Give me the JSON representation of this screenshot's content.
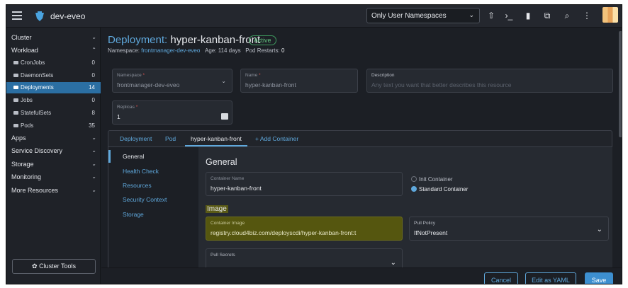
{
  "header": {
    "cluster_name": "dev-eveo",
    "namespace_filter": "Only User Namespaces",
    "icons": [
      "upload-icon",
      "kubectl-shell-icon",
      "file-icon",
      "copy-icon",
      "search-icon",
      "more-vert-icon"
    ]
  },
  "sidebar": {
    "sections": [
      {
        "label": "Cluster",
        "chev": "⌄"
      },
      {
        "label": "Workload",
        "chev": "⌃"
      }
    ],
    "workload_items": [
      {
        "label": "CronJobs",
        "count": "0"
      },
      {
        "label": "DaemonSets",
        "count": "0"
      },
      {
        "label": "Deployments",
        "count": "14"
      },
      {
        "label": "Jobs",
        "count": "0"
      },
      {
        "label": "StatefulSets",
        "count": "8"
      },
      {
        "label": "Pods",
        "count": "35"
      }
    ],
    "more_sections": [
      {
        "label": "Apps",
        "chev": "⌄"
      },
      {
        "label": "Service Discovery",
        "chev": "⌄"
      },
      {
        "label": "Storage",
        "chev": "⌄"
      },
      {
        "label": "Monitoring",
        "chev": "⌄"
      },
      {
        "label": "More Resources",
        "chev": "⌄"
      }
    ],
    "cluster_tools": "Cluster Tools"
  },
  "page": {
    "title_kind": "Deployment:",
    "title_name": "hyper-kanban-front",
    "status": "Active",
    "namespace_label": "Namespace:",
    "namespace_value": "frontmanager-dev-eveo",
    "age_label": "Age:",
    "age_value": "114 days",
    "restarts_label": "Pod Restarts:",
    "restarts_value": "0"
  },
  "form": {
    "namespace": {
      "label": "Namespace",
      "req": "*",
      "value": "frontmanager-dev-eveo"
    },
    "name": {
      "label": "Name",
      "req": "*",
      "value": "hyper-kanban-front"
    },
    "description": {
      "label": "Description",
      "placeholder": "Any text you want that better describes this resource"
    },
    "replicas": {
      "label": "Replicas",
      "req": "*",
      "value": "1"
    }
  },
  "tabs": [
    "Deployment",
    "Pod",
    "hyper-kanban-front",
    "+ Add Container"
  ],
  "side_tabs": [
    "General",
    "Health Check",
    "Resources",
    "Security Context",
    "Storage"
  ],
  "general": {
    "heading": "General",
    "container_name_label": "Container Name",
    "container_name_value": "hyper-kanban-front",
    "radio_init": "Init Container",
    "radio_standard": "Standard Container",
    "image_heading": "Image",
    "container_image_label": "Container Image",
    "container_image_value": "registry.cloud4biz.com/deployscdi/hyper-kanban-front:t",
    "pull_policy_label": "Pull Policy",
    "pull_policy_value": "IfNotPresent",
    "pull_secrets_label": "Pull Secrets"
  },
  "footer": {
    "cancel": "Cancel",
    "edit_yaml": "Edit as YAML",
    "save": "Save"
  },
  "colors": {
    "accent": "#5fa8dc",
    "active_badge": "#61c07e",
    "highlight": "#55560f"
  }
}
